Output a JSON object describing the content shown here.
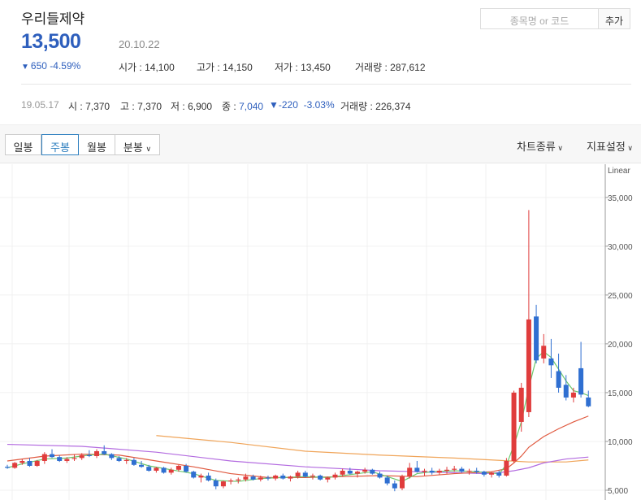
{
  "stock": {
    "name": "우리들제약",
    "price": "13,500",
    "date": "20.10.22",
    "change_arrow": "▼",
    "change": "650",
    "change_pct": "-4.59%"
  },
  "stats": {
    "open_label": "시가",
    "open": "14,100",
    "high_label": "고가",
    "high": "14,150",
    "low_label": "저가",
    "low": "13,450",
    "volume_label": "거래량",
    "volume": "287,612"
  },
  "search": {
    "placeholder": "종목명 or 코드",
    "add_label": "추가"
  },
  "history": {
    "date": "19.05.17",
    "open_label": "시",
    "open": "7,370",
    "high_label": "고",
    "high": "7,370",
    "low_label": "저",
    "low": "6,900",
    "close_label": "종",
    "close": "7,040",
    "change_arrow": "▼",
    "change": "-220",
    "change_pct": "-3.03%",
    "volume_label": "거래량",
    "volume": "226,374"
  },
  "tabs": [
    {
      "label": "일봉"
    },
    {
      "label": "주봉"
    },
    {
      "label": "월봉"
    },
    {
      "label": "분봉"
    }
  ],
  "active_tab": "주봉",
  "toolbar": {
    "chart_type": "차트종류",
    "indicator": "지표설정"
  },
  "colors": {
    "up": "#e03c3c",
    "down": "#2f6fd1",
    "price_blue": "#2e5fbd",
    "ma5": "#6dc86d",
    "ma20": "#e05a40",
    "ma60": "#b36be0",
    "ma120": "#f0a55a"
  },
  "chart_data": {
    "type": "candlestick",
    "scale_label": "Linear",
    "y_ticks": [
      5000,
      10000,
      15000,
      20000,
      25000,
      30000,
      35000
    ],
    "ylim": [
      4000,
      38400
    ],
    "candles": [
      [
        7400,
        7600,
        7200,
        7300
      ],
      [
        7300,
        7900,
        7200,
        7800
      ],
      [
        7800,
        8200,
        7600,
        8000
      ],
      [
        8000,
        8300,
        7400,
        7500
      ],
      [
        7500,
        8100,
        7400,
        8000
      ],
      [
        8000,
        8900,
        7700,
        8700
      ],
      [
        8700,
        9200,
        8300,
        8400
      ],
      [
        8400,
        8600,
        7900,
        8000
      ],
      [
        8000,
        8400,
        7800,
        8200
      ],
      [
        8200,
        8700,
        8000,
        8300
      ],
      [
        8300,
        8800,
        8100,
        8600
      ],
      [
        8600,
        9100,
        8400,
        8500
      ],
      [
        8500,
        9200,
        8300,
        9000
      ],
      [
        9000,
        9600,
        8600,
        8700
      ],
      [
        8700,
        8800,
        8100,
        8300
      ],
      [
        8300,
        8500,
        7900,
        8000
      ],
      [
        8000,
        8300,
        7700,
        8100
      ],
      [
        8100,
        8300,
        7500,
        7600
      ],
      [
        7600,
        8000,
        7300,
        7400
      ],
      [
        7400,
        7600,
        6900,
        7000
      ],
      [
        7000,
        7400,
        6800,
        7300
      ],
      [
        7300,
        7400,
        6700,
        6800
      ],
      [
        6800,
        7300,
        6600,
        7100
      ],
      [
        7100,
        7600,
        6900,
        7500
      ],
      [
        7500,
        7700,
        6800,
        6900
      ],
      [
        6900,
        7000,
        6200,
        6300
      ],
      [
        6300,
        6700,
        5800,
        6500
      ],
      [
        6500,
        6800,
        5900,
        6000
      ],
      [
        6000,
        6200,
        5100,
        5400
      ],
      [
        5400,
        6000,
        5200,
        5900
      ],
      [
        5900,
        6200,
        5600,
        6000
      ],
      [
        6000,
        6300,
        5700,
        6100
      ],
      [
        6100,
        6700,
        5900,
        6400
      ],
      [
        6400,
        6600,
        6000,
        6100
      ],
      [
        6100,
        6500,
        5900,
        6300
      ],
      [
        6300,
        6500,
        6000,
        6200
      ],
      [
        6200,
        6600,
        6000,
        6500
      ],
      [
        6500,
        6700,
        6100,
        6200
      ],
      [
        6200,
        6500,
        5900,
        6400
      ],
      [
        6400,
        7000,
        6200,
        6800
      ],
      [
        6800,
        7000,
        6300,
        6400
      ],
      [
        6400,
        6700,
        6100,
        6500
      ],
      [
        6500,
        6600,
        6000,
        6100
      ],
      [
        6100,
        6400,
        5800,
        6300
      ],
      [
        6300,
        6800,
        6100,
        6600
      ],
      [
        6600,
        7200,
        6400,
        7000
      ],
      [
        7000,
        7300,
        6600,
        6700
      ],
      [
        6700,
        7000,
        6300,
        6900
      ],
      [
        6900,
        7300,
        6700,
        7100
      ],
      [
        7100,
        7200,
        6600,
        6700
      ],
      [
        6700,
        6900,
        6200,
        6300
      ],
      [
        6300,
        6500,
        5500,
        5700
      ],
      [
        5700,
        6000,
        4900,
        5200
      ],
      [
        5200,
        6600,
        5000,
        6400
      ],
      [
        6400,
        7800,
        6200,
        7300
      ],
      [
        7300,
        8000,
        6800,
        6900
      ],
      [
        6900,
        7200,
        6500,
        7000
      ],
      [
        7000,
        7300,
        6600,
        6800
      ],
      [
        6800,
        7200,
        6600,
        7000
      ],
      [
        7000,
        7400,
        6700,
        7100
      ],
      [
        7100,
        7500,
        6900,
        7200
      ],
      [
        7200,
        7400,
        6800,
        6900
      ],
      [
        6900,
        7200,
        6600,
        7000
      ],
      [
        7000,
        7300,
        6700,
        6900
      ],
      [
        6900,
        7000,
        6400,
        6600
      ],
      [
        6600,
        6900,
        6300,
        6800
      ],
      [
        6800,
        7000,
        6300,
        6500
      ],
      [
        6500,
        8300,
        6400,
        8000
      ],
      [
        8000,
        15200,
        7800,
        15000
      ],
      [
        12000,
        16000,
        11000,
        15500
      ],
      [
        13000,
        33700,
        12500,
        22500
      ],
      [
        22800,
        24000,
        18000,
        18300
      ],
      [
        18500,
        21000,
        18000,
        19800
      ],
      [
        18500,
        20500,
        16500,
        17800
      ],
      [
        17200,
        19000,
        15000,
        15500
      ],
      [
        15800,
        16800,
        14200,
        14500
      ],
      [
        14500,
        15500,
        14000,
        15000
      ],
      [
        17500,
        20200,
        14500,
        14800
      ],
      [
        14500,
        15200,
        13500,
        13600
      ]
    ],
    "ma5": [
      [
        0,
        7300
      ],
      [
        2,
        7700
      ],
      [
        5,
        8200
      ],
      [
        8,
        8300
      ],
      [
        11,
        8600
      ],
      [
        13,
        8700
      ],
      [
        16,
        8200
      ],
      [
        19,
        7500
      ],
      [
        22,
        7100
      ],
      [
        25,
        6700
      ],
      [
        28,
        6000
      ],
      [
        31,
        5900
      ],
      [
        34,
        6200
      ],
      [
        37,
        6300
      ],
      [
        40,
        6400
      ],
      [
        43,
        6300
      ],
      [
        46,
        6600
      ],
      [
        49,
        6900
      ],
      [
        51,
        6400
      ],
      [
        53,
        5900
      ],
      [
        55,
        6700
      ],
      [
        57,
        6900
      ],
      [
        60,
        7000
      ],
      [
        63,
        6900
      ],
      [
        66,
        6700
      ],
      [
        67,
        7600
      ],
      [
        68,
        9600
      ],
      [
        69,
        12000
      ],
      [
        70,
        15500
      ],
      [
        71,
        18500
      ],
      [
        72,
        19200
      ],
      [
        73,
        18600
      ],
      [
        74,
        17400
      ],
      [
        75,
        16200
      ],
      [
        76,
        15200
      ],
      [
        77,
        15000
      ],
      [
        78,
        14700
      ]
    ],
    "ma20": [
      [
        0,
        8000
      ],
      [
        5,
        8500
      ],
      [
        10,
        8700
      ],
      [
        15,
        8600
      ],
      [
        20,
        8000
      ],
      [
        25,
        7400
      ],
      [
        30,
        6700
      ],
      [
        35,
        6300
      ],
      [
        40,
        6300
      ],
      [
        45,
        6400
      ],
      [
        50,
        6500
      ],
      [
        55,
        6400
      ],
      [
        60,
        6700
      ],
      [
        65,
        6900
      ],
      [
        67,
        7200
      ],
      [
        68,
        7800
      ],
      [
        69,
        8500
      ],
      [
        70,
        9400
      ],
      [
        72,
        10500
      ],
      [
        74,
        11300
      ],
      [
        76,
        12000
      ],
      [
        78,
        12600
      ]
    ],
    "ma60": [
      [
        0,
        9700
      ],
      [
        10,
        9500
      ],
      [
        20,
        8900
      ],
      [
        30,
        8000
      ],
      [
        40,
        7400
      ],
      [
        50,
        7000
      ],
      [
        60,
        6800
      ],
      [
        64,
        6700
      ],
      [
        66,
        6800
      ],
      [
        68,
        7000
      ],
      [
        70,
        7300
      ],
      [
        72,
        7800
      ],
      [
        75,
        8200
      ],
      [
        78,
        8400
      ]
    ],
    "ma120": [
      [
        20,
        10600
      ],
      [
        30,
        9900
      ],
      [
        40,
        9000
      ],
      [
        50,
        8600
      ],
      [
        60,
        8300
      ],
      [
        65,
        8100
      ],
      [
        70,
        7900
      ],
      [
        75,
        7900
      ],
      [
        78,
        8100
      ]
    ]
  }
}
